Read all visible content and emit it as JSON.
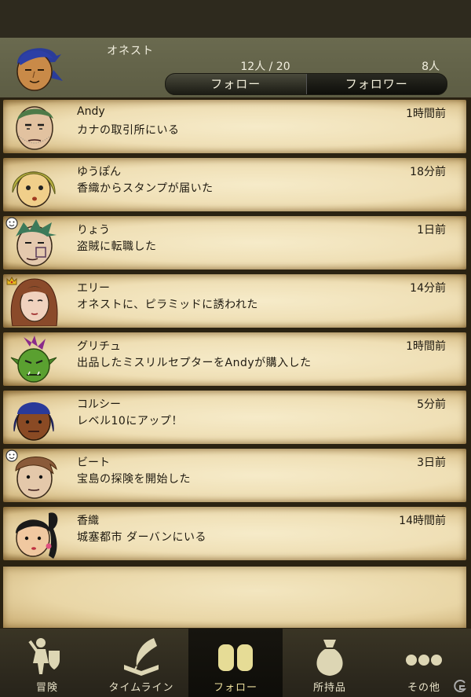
{
  "profile": {
    "name": "オネスト",
    "follow_count": "12人 / 20",
    "follower_count": "8人",
    "tabs": {
      "follow": "フォロー",
      "follower": "フォロワー"
    },
    "active_tab": "follow"
  },
  "timeline": [
    {
      "name": "Andy",
      "message": "カナの取引所にいる",
      "time": "1時間前",
      "avatar": "andy-face-icon"
    },
    {
      "name": "ゆうぽん",
      "message": "香織からスタンプが届いた",
      "time": "18分前",
      "avatar": "yuupon-face-icon"
    },
    {
      "name": "りょう",
      "message": "盗賊に転職した",
      "time": "1日前",
      "avatar": "ryou-face-icon"
    },
    {
      "name": "エリー",
      "message": "オネストに、ピラミッドに誘われた",
      "time": "14分前",
      "avatar": "elly-face-icon"
    },
    {
      "name": "グリチュ",
      "message": "出品したミスリルセプターをAndyが購入した",
      "time": "1時間前",
      "avatar": "orc-face-icon"
    },
    {
      "name": "コルシー",
      "message": "レベル10にアップ！",
      "time": "5分前",
      "avatar": "corsie-face-icon"
    },
    {
      "name": "ビート",
      "message": "宝島の探険を開始した",
      "time": "3日前",
      "avatar": "beat-face-icon"
    },
    {
      "name": "香織",
      "message": "城塞都市 ダーバンにいる",
      "time": "14時間前",
      "avatar": "kaori-face-icon"
    }
  ],
  "nav": {
    "adventure": "冒険",
    "timeline": "タイムライン",
    "follow": "フォロー",
    "items": "所持品",
    "other": "その他",
    "active": "follow"
  },
  "colors": {
    "parchment": "#efdfb5",
    "bar": "#5d5d44",
    "active_tab_text": "#ecdf9c"
  }
}
